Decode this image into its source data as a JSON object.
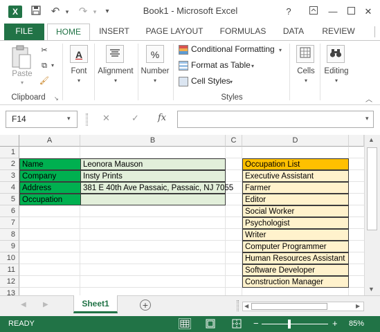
{
  "window": {
    "title": "Book1 - Microsoft Excel",
    "controls": {
      "help": "?",
      "restore_ribbon": "⧉",
      "minimize": "—",
      "maximize": "☐",
      "close": "✕"
    }
  },
  "qat": {
    "save": "💾",
    "undo": "↶",
    "redo": "↷",
    "customize": "⌄"
  },
  "tabs": [
    "FILE",
    "HOME",
    "INSERT",
    "PAGE LAYOUT",
    "FORMULAS",
    "DATA",
    "REVIEW"
  ],
  "ribbon": {
    "clipboard": {
      "paste": "Paste",
      "group": "Clipboard"
    },
    "font": {
      "label": "Font",
      "icon": "A"
    },
    "alignment": {
      "label": "Alignment"
    },
    "number": {
      "label": "Number",
      "icon": "%"
    },
    "styles": {
      "conditional": "Conditional Formatting",
      "format_table": "Format as Table",
      "cell_styles": "Cell Styles",
      "group": "Styles"
    },
    "cells": {
      "label": "Cells"
    },
    "editing": {
      "label": "Editing"
    }
  },
  "formula_bar": {
    "name_box": "F14",
    "fx": "fx",
    "value": ""
  },
  "grid": {
    "columns": [
      "A",
      "B",
      "C",
      "D"
    ],
    "rows": [
      "1",
      "2",
      "3",
      "4",
      "5",
      "6",
      "7",
      "8",
      "9",
      "10",
      "11",
      "12",
      "13"
    ],
    "cells": {
      "A2": "Name",
      "A3": "Company",
      "A4": "Address",
      "A5": "Occupation",
      "B2": "Leonora Mauson",
      "B3": "Insty Prints",
      "B4": "381 E 40th Ave Passaic, Passaic, NJ 7055",
      "B5": ""
    },
    "occupation_list": {
      "header": "Occupation List",
      "items": [
        "Executive Assistant",
        "Farmer",
        "Editor",
        "Social Worker",
        "Psychologist",
        "Writer",
        "Computer Programmer",
        "Human Resources Assistant",
        "Software Developer",
        "Construction Manager"
      ]
    }
  },
  "sheets": {
    "active": "Sheet1",
    "add": "+"
  },
  "status_bar": {
    "ready": "READY",
    "zoom": "85%",
    "minus": "−",
    "plus": "+"
  },
  "colors": {
    "excel_green": "#217346",
    "label_green": "#00b050",
    "value_light_green": "#e2efda",
    "header_orange": "#ffc000",
    "item_light_orange": "#fff2cc"
  }
}
